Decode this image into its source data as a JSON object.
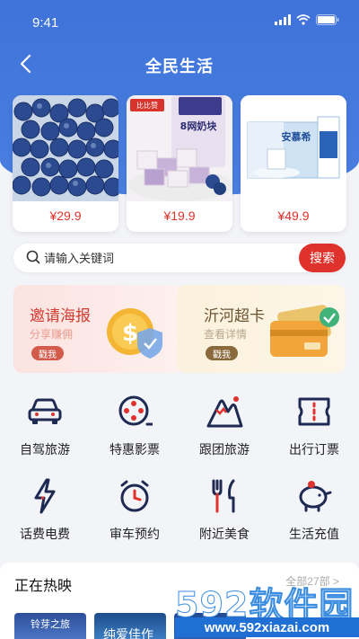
{
  "status_bar": {
    "time": "9:41"
  },
  "nav": {
    "title": "全民生活"
  },
  "products": [
    {
      "price": "¥29.9",
      "image": "blueberries"
    },
    {
      "price": "¥19.9",
      "image": "freeze-dried-yogurt-cubes",
      "brand": "比比赞",
      "pack_text": "8网奶块"
    },
    {
      "price": "¥49.9",
      "image": "yogurt-milk-box",
      "brand": "安慕希"
    }
  ],
  "search": {
    "placeholder": "请输入关键词",
    "button": "搜索"
  },
  "promos": [
    {
      "title": "邀请海报",
      "subtitle": "分享赚佣",
      "button": "戳我"
    },
    {
      "title": "沂河超卡",
      "subtitle": "查看详情",
      "button": "戳我"
    }
  ],
  "services": [
    {
      "label": "自驾旅游",
      "icon": "car-icon"
    },
    {
      "label": "特惠影票",
      "icon": "film-reel-icon"
    },
    {
      "label": "跟团旅游",
      "icon": "mountain-icon"
    },
    {
      "label": "出行订票",
      "icon": "ticket-icon"
    },
    {
      "label": "话费电费",
      "icon": "lightning-icon"
    },
    {
      "label": "审车预约",
      "icon": "alarm-clock-icon"
    },
    {
      "label": "附近美食",
      "icon": "fork-knife-icon"
    },
    {
      "label": "生活充值",
      "icon": "piggy-bank-icon"
    }
  ],
  "hot": {
    "title": "正在热映",
    "more": "全部27部 >"
  },
  "posters": [
    {
      "text": "铃芽之旅"
    },
    {
      "text": "纯爱佳作"
    },
    {
      "text": ""
    }
  ],
  "watermark": {
    "brand": "592软件园",
    "url": "www.592xiazai.com"
  },
  "colors": {
    "header": "#3f73d9",
    "accent_red": "#e0322c",
    "icon_navy": "#1e2a52"
  }
}
